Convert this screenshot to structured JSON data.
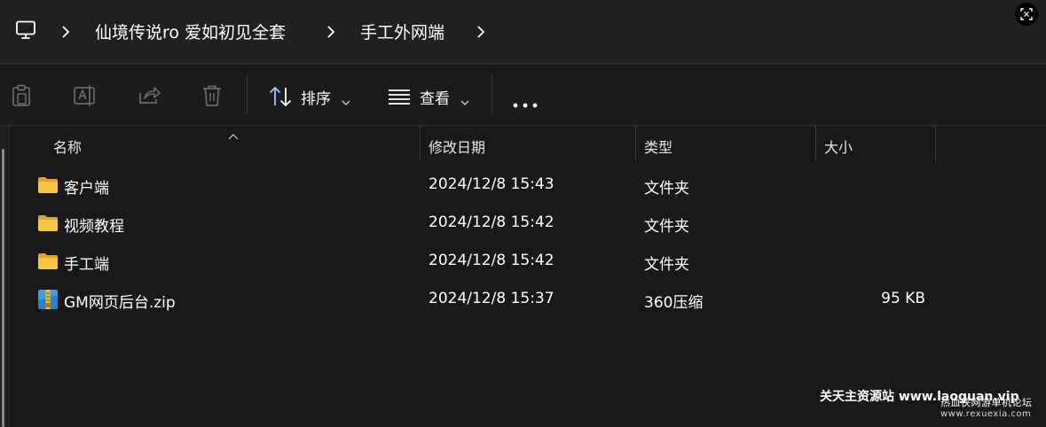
{
  "breadcrumb": {
    "items": [
      "仙境传说ro 爱如初见全套",
      "手工外网端"
    ]
  },
  "toolbar": {
    "sort_label": "排序",
    "view_label": "查看",
    "icons": [
      "paste-icon",
      "rename-icon",
      "share-icon",
      "delete-icon",
      "sort-icon",
      "view-icon",
      "more-icon"
    ]
  },
  "columns": {
    "name": "名称",
    "date": "修改日期",
    "type": "类型",
    "size": "大小"
  },
  "files": [
    {
      "name": "客户端",
      "date": "2024/12/8 15:43",
      "type": "文件夹",
      "size": "",
      "icon": "folder-icon"
    },
    {
      "name": "视频教程",
      "date": "2024/12/8 15:42",
      "type": "文件夹",
      "size": "",
      "icon": "folder-icon"
    },
    {
      "name": "手工端",
      "date": "2024/12/8 15:42",
      "type": "文件夹",
      "size": "",
      "icon": "folder-icon"
    },
    {
      "name": "GM网页后台.zip",
      "date": "2024/12/8 15:37",
      "type": "360压缩",
      "size": "95 KB",
      "icon": "zip-archive-icon"
    }
  ],
  "watermark": {
    "line1": "关天主资源站 www.laoguan.vip",
    "line2": "热血侠网游单机论坛",
    "line3": "www.rexuexia.com"
  },
  "colors": {
    "background": "#191919",
    "addressbar": "#202020",
    "folder": "#f5c544"
  }
}
